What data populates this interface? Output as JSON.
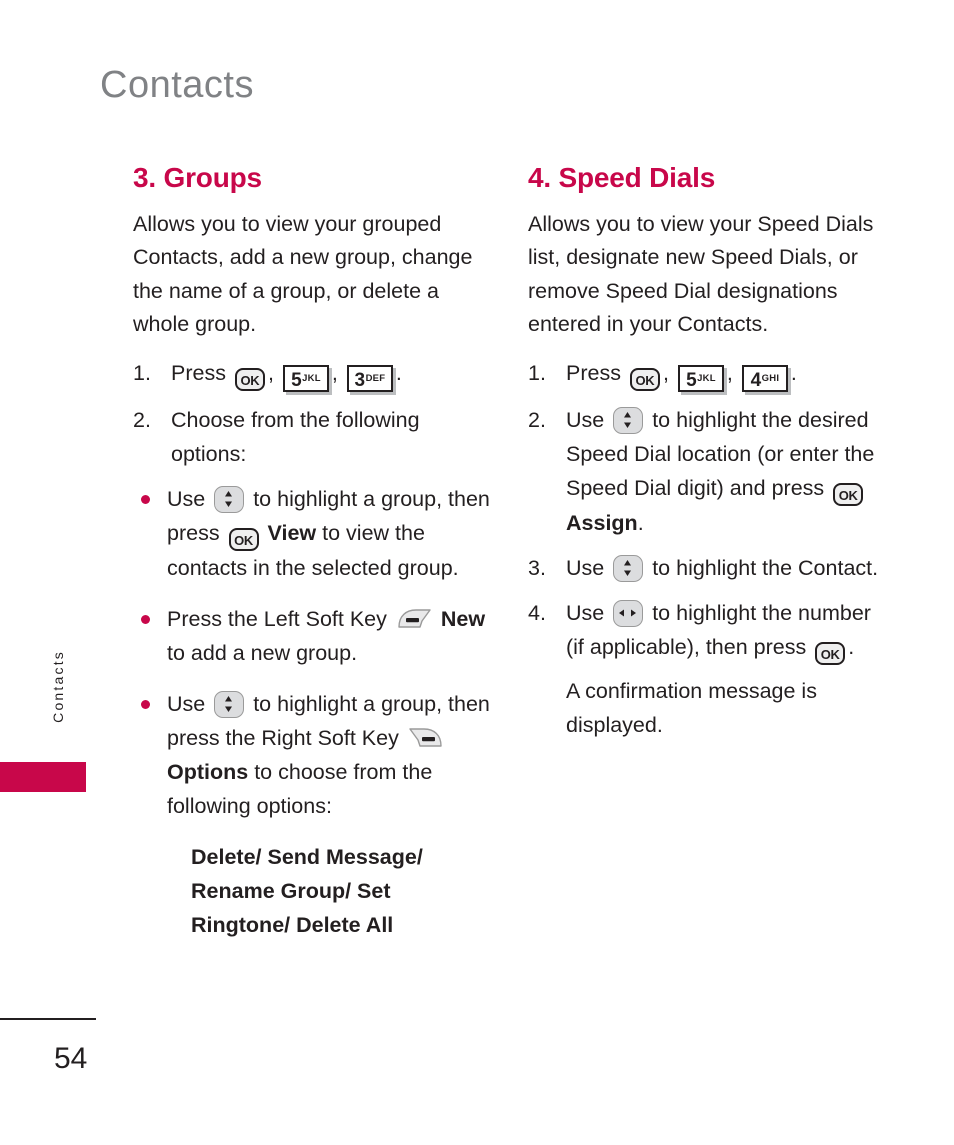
{
  "page": {
    "header_title": "Contacts",
    "side_tab_label": "Contacts",
    "page_number": "54"
  },
  "colors": {
    "accent": "#c8074a",
    "header_gray": "#808285",
    "body_text": "#231f20",
    "key_face": "#dcdddf"
  },
  "icons": {
    "ok_key": "OK",
    "key_5_digit": "5",
    "key_5_letters": "JKL",
    "key_3_digit": "3",
    "key_3_letters": "DEF",
    "key_4_digit": "4",
    "key_4_letters": "GHI"
  },
  "left_column": {
    "title": "3. Groups",
    "intro": "Allows you to view your grouped Contacts, add a new group, change the name of a group, or delete a whole group.",
    "steps": [
      {
        "num": "1.",
        "pre": "Press",
        "mid1": ",",
        "mid2": ",",
        "post": "."
      },
      {
        "num": "2.",
        "text": "Choose from the following options:"
      }
    ],
    "bullets": [
      {
        "pre": "Use",
        "mid": "to highlight a group, then press",
        "bold": "View",
        "post": "to view the contacts in the selected group."
      },
      {
        "pre": "Press the Left Soft Key",
        "bold": "New",
        "post": "to add a new group."
      },
      {
        "pre": "Use",
        "mid": "to highlight a group, then press the Right Soft Key",
        "bold": "Options",
        "post": "to choose from the following options:"
      }
    ],
    "options_list": "Delete/ Send Message/ Rename Group/ Set Ringtone/ Delete All"
  },
  "right_column": {
    "title": "4. Speed Dials",
    "intro": "Allows you to view your Speed Dials list, designate new Speed Dials, or remove Speed Dial designations entered in your Contacts.",
    "steps": [
      {
        "num": "1.",
        "pre": "Press",
        "mid1": ",",
        "mid2": ",",
        "post": "."
      },
      {
        "num": "2.",
        "pre": "Use",
        "mid": "to highlight the desired Speed Dial location (or enter the Speed Dial digit) and press",
        "bold": "Assign",
        "post": "."
      },
      {
        "num": "3.",
        "pre": "Use",
        "mid": "to highlight the Contact.",
        "post": ""
      },
      {
        "num": "4.",
        "pre": "Use",
        "mid": "to highlight the number (if applicable), then press",
        "post": "."
      }
    ],
    "note": "A confirmation message is displayed."
  }
}
